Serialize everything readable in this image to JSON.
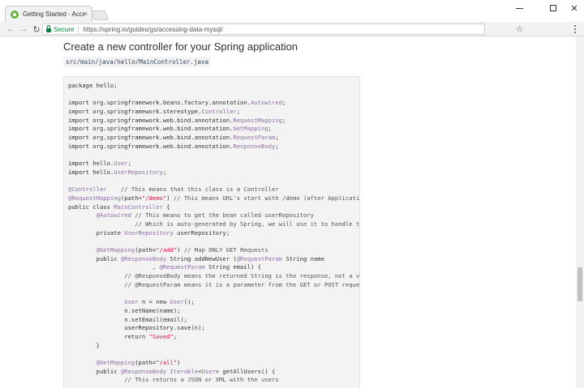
{
  "browser": {
    "tab_title": "Getting Started · Accessi",
    "tab_close": "×",
    "security_label": "Secure",
    "url": "https://spring.io/guides/gs/accessing-data-mysql/",
    "icons": [
      "back-arrow-icon",
      "forward-arrow-icon",
      "reload-icon",
      "lock-icon",
      "star-icon",
      "menu-icon",
      "minimize-icon",
      "maximize-icon",
      "close-icon"
    ]
  },
  "page": {
    "heading": "Create a new controller for your Spring application",
    "file_path": "src/main/java/hello/MainController.java",
    "code_lines": [
      "package hello;",
      "",
      "import org.springframework.beans.factory.annotation.Autowired;",
      "import org.springframework.stereotype.Controller;",
      "import org.springframework.web.bind.annotation.RequestMapping;",
      "import org.springframework.web.bind.annotation.GetMapping;",
      "import org.springframework.web.bind.annotation.RequestParam;",
      "import org.springframework.web.bind.annotation.ResponseBody;",
      "",
      "import hello.User;",
      "import hello.UserRepository;",
      "",
      "@Controller    // This means that this class is a Controller",
      "@RequestMapping(path=\"/demo\") // This means URL's start with /demo (after Application",
      "public class MainController {",
      "        @Autowired // This means to get the bean called userRepository",
      "                   // Which is auto-generated by Spring, we will use it to handle the d",
      "        private UserRepository userRepository;",
      "",
      "        @GetMapping(path=\"/add\") // Map ONLY GET Requests",
      "        public @ResponseBody String addNewUser (@RequestParam String name",
      "                        , @RequestParam String email) {",
      "                // @ResponseBody means the returned String is the response, not a view",
      "                // @RequestParam means it is a parameter from the GET or POST request",
      "",
      "                User n = new User();",
      "                n.setName(name);",
      "                n.setEmail(email);",
      "                userRepository.save(n);",
      "                return \"Saved\";",
      "        }",
      "",
      "        @GetMapping(path=\"/all\")",
      "        public @ResponseBody Iterable<User> getAllUsers() {",
      "                // This returns a JSON or XML with the users"
    ]
  },
  "colors": {
    "token": "#8e6fa4",
    "string": "#d14",
    "secure": "#0b8043",
    "spring_green": "#6db33f"
  }
}
